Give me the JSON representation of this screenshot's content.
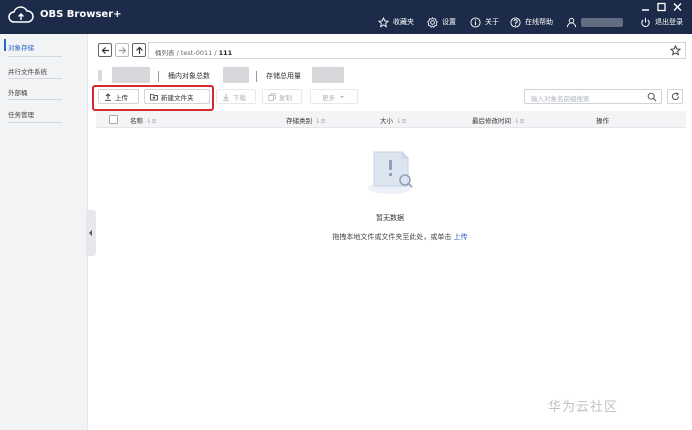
{
  "app": {
    "name": "OBS Browser+"
  },
  "topbar": {
    "favorites": "收藏夹",
    "settings": "设置",
    "about": "关于",
    "help": "在线帮助",
    "logout": "退出登录"
  },
  "sidebar": {
    "items": [
      {
        "label": "对象存储"
      },
      {
        "label": "并行文件系统"
      },
      {
        "label": "外部桶"
      },
      {
        "label": "任务管理"
      }
    ]
  },
  "path": {
    "root": "桶列表",
    "sep1": "/",
    "bucket": "test-0011",
    "sep2": "/",
    "folder": "111"
  },
  "stats": {
    "object_count_label": "桶内对象总数",
    "storage_label": "存储总用量"
  },
  "toolbar": {
    "upload": "上传",
    "new_folder": "新建文件夹",
    "download": "下载",
    "copy": "复制",
    "more": "更多",
    "search_placeholder": "输入对象名前缀搜索"
  },
  "table": {
    "columns": [
      "名称",
      "存储类别",
      "大小",
      "最后修改时间",
      "操作"
    ]
  },
  "empty": {
    "title": "暂无数据",
    "hint_prefix": "拖拽本地文件或文件夹至此处，或单击",
    "hint_link": "上传"
  },
  "watermark": "华为云社区"
}
